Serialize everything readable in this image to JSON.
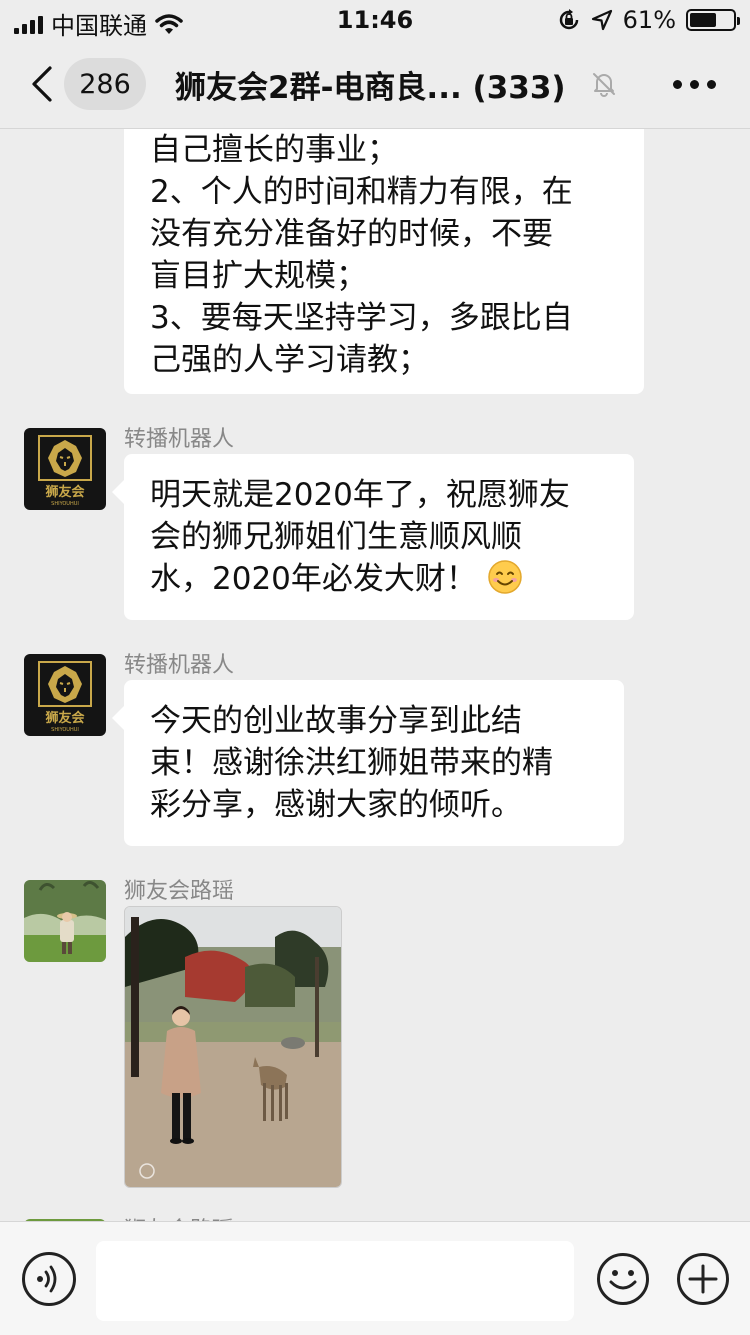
{
  "status_bar": {
    "carrier": "中国联通",
    "time": "11:46",
    "battery_percent": "61%",
    "battery_level": 0.61,
    "icons": [
      "signal-icon",
      "wifi-icon",
      "orientation-lock-icon",
      "location-icon",
      "battery-icon"
    ]
  },
  "header": {
    "unread_count": "286",
    "title": "狮友会2群-电商良... (333)",
    "icons": [
      "back-chevron-icon",
      "mute-bell-icon",
      "more-dots-icon"
    ]
  },
  "messages": [
    {
      "lines": [
        "自己擅长的事业；",
        "2、个人的时间和精力有限，在",
        "没有充分准备好的时候，不要",
        "盲目扩大规模；",
        "3、要每天坚持学习，多跟比自",
        "己强的人学习请教；"
      ]
    },
    {
      "sender": "转播机器人",
      "avatar_text": "狮友会",
      "avatar_subtext": "SHIYOUHUI",
      "lines": [
        "明天就是2020年了，祝愿狮友",
        "会的狮兄狮姐们生意顺风顺",
        "水，2020年必发大财！"
      ],
      "emoji": "smiling-face-icon"
    },
    {
      "sender": "转播机器人",
      "avatar_text": "狮友会",
      "avatar_subtext": "SHIYOUHUI",
      "lines": [
        "今天的创业故事分享到此结",
        "束！感谢徐洪红狮姐带来的精",
        "彩分享，感谢大家的倾听。"
      ]
    },
    {
      "sender": "狮友会路瑶",
      "type": "image"
    },
    {
      "sender": "狮友会路瑶"
    }
  ],
  "input_bar": {
    "value": "",
    "icons": [
      "voice-icon",
      "emoji-icon",
      "plus-icon"
    ]
  },
  "colors": {
    "background": "#ededed",
    "bubble": "#ffffff",
    "sender_text": "#888888",
    "lion_gold": "#c9a84a"
  }
}
